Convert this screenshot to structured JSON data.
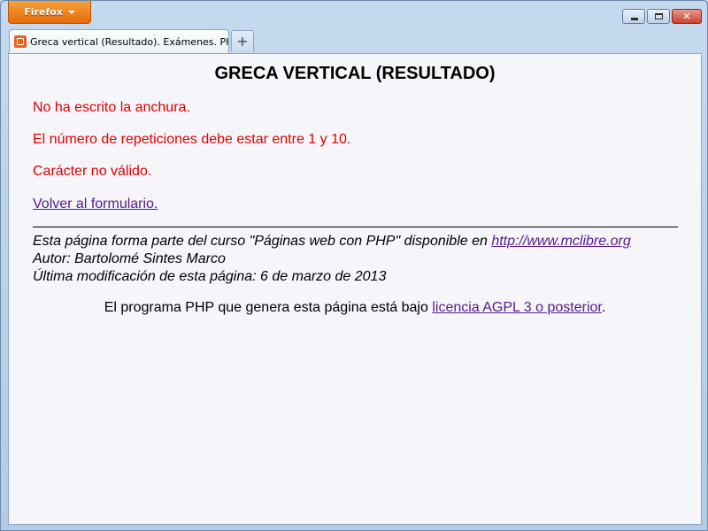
{
  "browser": {
    "menu_button_label": "Firefox",
    "tab_title": "Greca vertical (Resultado). Exámenes. PH...",
    "new_tab_symbol": "+",
    "close_symbol": "✕"
  },
  "page": {
    "heading": "GRECA VERTICAL (RESULTADO)",
    "errors": [
      "No ha escrito la anchura.",
      "El número de repeticiones debe estar entre 1 y 10.",
      "Carácter no válido."
    ],
    "back_link": "Volver al formulario.",
    "footer": {
      "line1_prefix": "Esta página forma parte del curso \"Páginas web con PHP\" disponible en ",
      "line1_link": "http://www.mclibre.org",
      "line2": "Autor: Bartolomé Sintes Marco",
      "line3": "Última modificación de esta página: 6 de marzo de 2013"
    },
    "license": {
      "prefix": "El programa PHP que genera esta página está bajo ",
      "link": "licencia AGPL 3 o posterior",
      "suffix": "."
    }
  },
  "colors": {
    "error_text": "#e00000",
    "link_visited": "#551a8b",
    "page_background": "#f5f5fa",
    "firefox_button": "#e56b0b"
  }
}
